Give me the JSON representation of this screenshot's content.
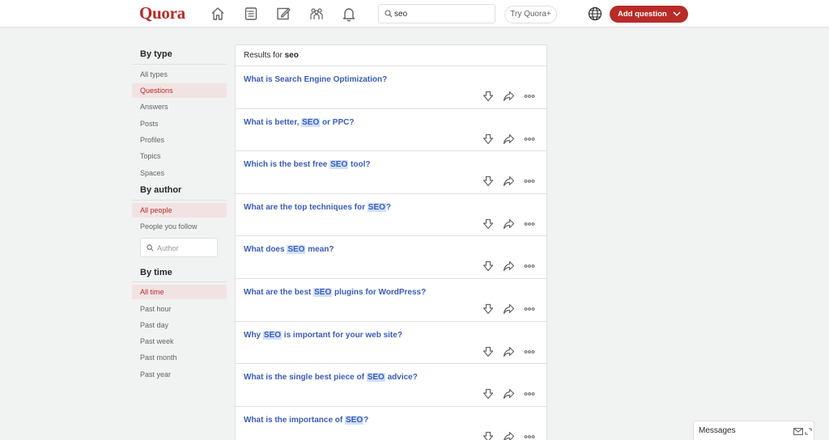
{
  "header": {
    "logo": "Quora",
    "search_value": "seo",
    "try_label": "Try Quora+",
    "add_question_label": "Add question"
  },
  "sidebar": {
    "by_type_title": "By type",
    "type_items": [
      "All types",
      "Questions",
      "Answers",
      "Posts",
      "Profiles",
      "Topics",
      "Spaces"
    ],
    "by_author_title": "By author",
    "author_items": [
      "All people",
      "People you follow"
    ],
    "author_placeholder": "Author",
    "by_time_title": "By time",
    "time_items": [
      "All time",
      "Past hour",
      "Past day",
      "Past week",
      "Past month",
      "Past year"
    ]
  },
  "results": {
    "prefix": "Results for",
    "query": "seo",
    "questions": [
      {
        "pre": "What is Search Engine Optimization?",
        "hl": "",
        "post": ""
      },
      {
        "pre": "What is better, ",
        "hl": "SEO",
        "post": " or PPC?"
      },
      {
        "pre": "Which is the best free ",
        "hl": "SEO",
        "post": " tool?"
      },
      {
        "pre": "What are the top techniques for ",
        "hl": "SEO",
        "post": "?"
      },
      {
        "pre": "What does ",
        "hl": "SEO",
        "post": " mean?"
      },
      {
        "pre": "What are the best ",
        "hl": "SEO",
        "post": " plugins for WordPress?"
      },
      {
        "pre": "Why ",
        "hl": "SEO",
        "post": " is important for your web site?"
      },
      {
        "pre": "What is the single best piece of ",
        "hl": "SEO",
        "post": " advice?"
      },
      {
        "pre": "What is the importance of ",
        "hl": "SEO",
        "post": "?"
      }
    ]
  },
  "messages": {
    "label": "Messages"
  },
  "colors": {
    "brand": "#b92b27",
    "link": "#3b5cb8",
    "highlight": "#cfe0fc",
    "active_bg": "#f2e3e3"
  }
}
